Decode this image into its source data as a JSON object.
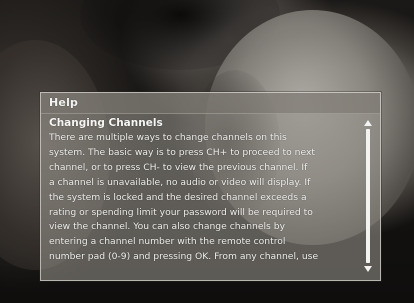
{
  "help_dialog": {
    "title": "Help",
    "section_heading": "Changing Channels",
    "body_lines": [
      "There are multiple ways to change channels on this",
      "system.  The basic way is to press CH+ to proceed to next",
      "channel, or to press CH- to view the previous channel.  If",
      "a channel is unavailable, no audio or video will display.  If",
      "the system is locked and the desired channel exceeds a",
      "rating or spending limit your password will be required to",
      "view the channel.  You can also change channels by",
      "entering a channel number with the remote control",
      "number pad (0-9) and pressing OK.  From any channel, use"
    ],
    "scrollbar": {
      "up_icon": "arrow-up-icon",
      "down_icon": "arrow-down-icon"
    }
  },
  "colors": {
    "panel_fill": "#96928c",
    "panel_border": "#d7d4ce",
    "text": "#efefec"
  }
}
